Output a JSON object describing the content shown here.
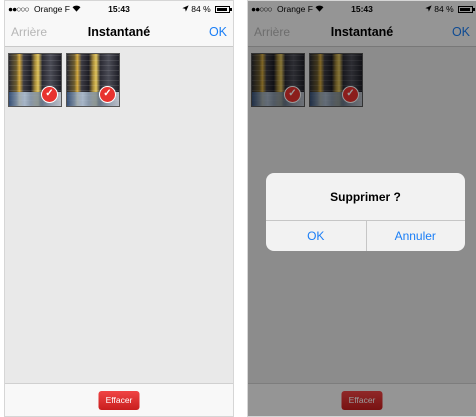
{
  "screens": [
    {
      "statusbar": {
        "signal_dots": "●●○○○",
        "carrier": "Orange F",
        "wifi": "wifi-icon",
        "time": "15:43",
        "location_arrow": "location-arrow-icon",
        "battery_text": "84 %"
      },
      "navbar": {
        "back_label": "Arrière",
        "title": "Instantané",
        "ok_label": "OK"
      },
      "thumbnails": [
        {
          "selected": true
        },
        {
          "selected": true
        }
      ],
      "bottombar": {
        "delete_label": "Effacer"
      }
    },
    {
      "statusbar": {
        "signal_dots": "●●○○○",
        "carrier": "Orange F",
        "wifi": "wifi-icon",
        "time": "15:43",
        "location_arrow": "location-arrow-icon",
        "battery_text": "84 %"
      },
      "navbar": {
        "back_label": "Arrière",
        "title": "Instantané",
        "ok_label": "OK"
      },
      "thumbnails": [
        {
          "selected": true
        },
        {
          "selected": true
        }
      ],
      "bottombar": {
        "delete_label": "Effacer"
      },
      "alert": {
        "title": "Supprimer ?",
        "confirm_label": "OK",
        "cancel_label": "Annuler"
      }
    }
  ],
  "colors": {
    "accent": "#1a7ef6",
    "destructive": "#d62b2b",
    "check_badge": "#e8322f"
  },
  "check_glyph": "✓"
}
